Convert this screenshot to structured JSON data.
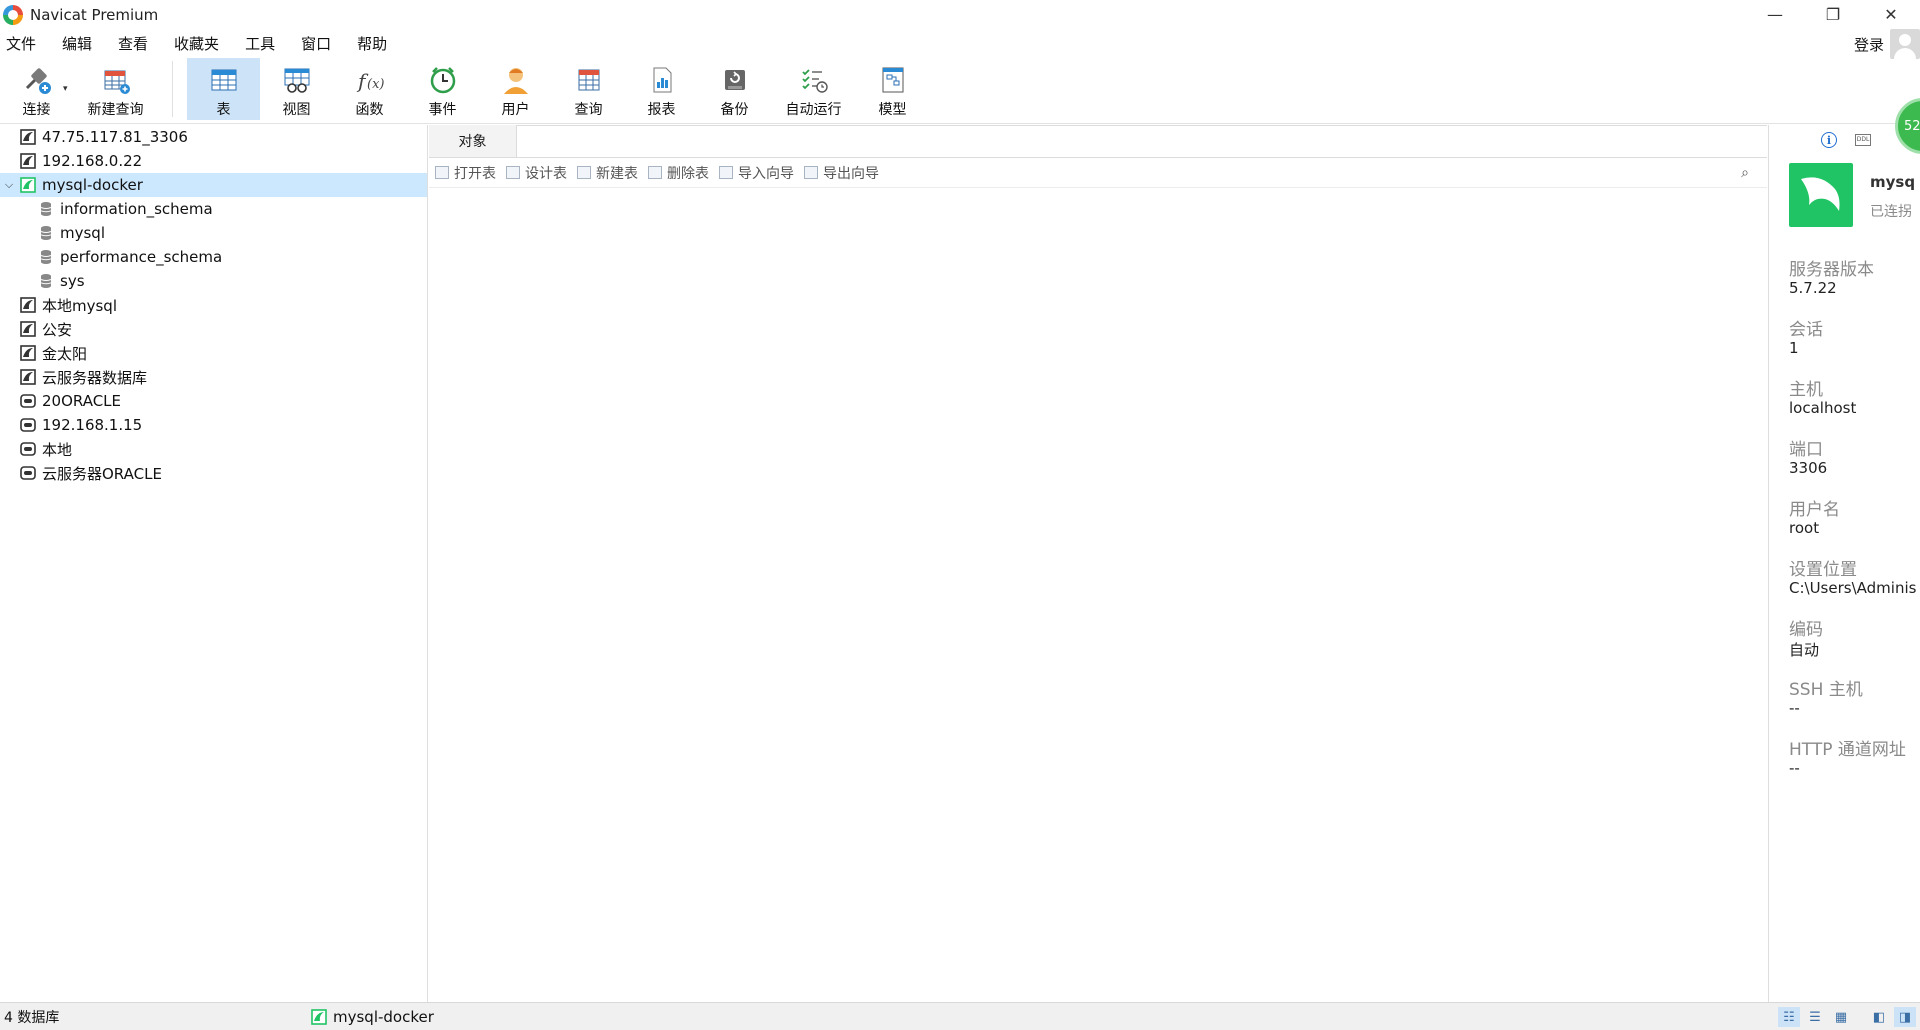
{
  "window": {
    "title": "Navicat Premium",
    "controls": {
      "minimize": "—",
      "restore": "❐",
      "close": "✕"
    }
  },
  "menu": {
    "items": [
      "文件",
      "编辑",
      "查看",
      "收藏夹",
      "工具",
      "窗口",
      "帮助"
    ],
    "login": "登录"
  },
  "toolbar": {
    "items": [
      {
        "label": "连接",
        "icon": "connect-icon"
      },
      {
        "label": "新建查询",
        "icon": "new-query-icon"
      },
      {
        "label": "表",
        "icon": "table-icon",
        "active": true
      },
      {
        "label": "视图",
        "icon": "view-icon"
      },
      {
        "label": "函数",
        "icon": "function-icon"
      },
      {
        "label": "事件",
        "icon": "event-icon"
      },
      {
        "label": "用户",
        "icon": "user-icon"
      },
      {
        "label": "查询",
        "icon": "query-icon"
      },
      {
        "label": "报表",
        "icon": "report-icon"
      },
      {
        "label": "备份",
        "icon": "backup-icon"
      },
      {
        "label": "自动运行",
        "icon": "automation-icon"
      },
      {
        "label": "模型",
        "icon": "model-icon"
      }
    ]
  },
  "navigator": {
    "connections": [
      {
        "label": "47.75.117.81_3306",
        "type": "mysql"
      },
      {
        "label": "192.168.0.22",
        "type": "mysql"
      },
      {
        "label": "mysql-docker",
        "type": "mysql-open",
        "selected": true,
        "expanded": true,
        "databases": [
          "information_schema",
          "mysql",
          "performance_schema",
          "sys"
        ]
      },
      {
        "label": "本地mysql",
        "type": "mysql"
      },
      {
        "label": "公安",
        "type": "mysql"
      },
      {
        "label": "金太阳",
        "type": "mysql"
      },
      {
        "label": "云服务器数据库",
        "type": "mysql"
      },
      {
        "label": "20ORACLE",
        "type": "oracle"
      },
      {
        "label": "192.168.1.15",
        "type": "oracle"
      },
      {
        "label": "本地",
        "type": "oracle"
      },
      {
        "label": "云服务器ORACLE",
        "type": "oracle"
      }
    ]
  },
  "main": {
    "tab": "对象",
    "object_actions": [
      "打开表",
      "设计表",
      "新建表",
      "删除表",
      "导入向导",
      "导出向导"
    ],
    "search_icon": "search-icon"
  },
  "info_panel": {
    "connection_name": "mysq",
    "connection_status": "已连拐",
    "fields": [
      {
        "key": "服务器版本",
        "value": "5.7.22"
      },
      {
        "key": "会话",
        "value": "1"
      },
      {
        "key": "主机",
        "value": "localhost"
      },
      {
        "key": "端口",
        "value": "3306"
      },
      {
        "key": "用户名",
        "value": "root"
      },
      {
        "key": "设置位置",
        "value": "C:\\Users\\Adminis"
      },
      {
        "key": "编码",
        "value": "自动"
      },
      {
        "key": "SSH 主机",
        "value": "--"
      },
      {
        "key": "HTTP 通道网址",
        "value": "--"
      }
    ]
  },
  "badge": "52",
  "statusbar": {
    "db_count": "4 数据库",
    "connection": "mysql-docker"
  },
  "colors": {
    "accent": "#cde3f7",
    "selection": "#cce8ff",
    "mysql_green": "#20c464"
  }
}
